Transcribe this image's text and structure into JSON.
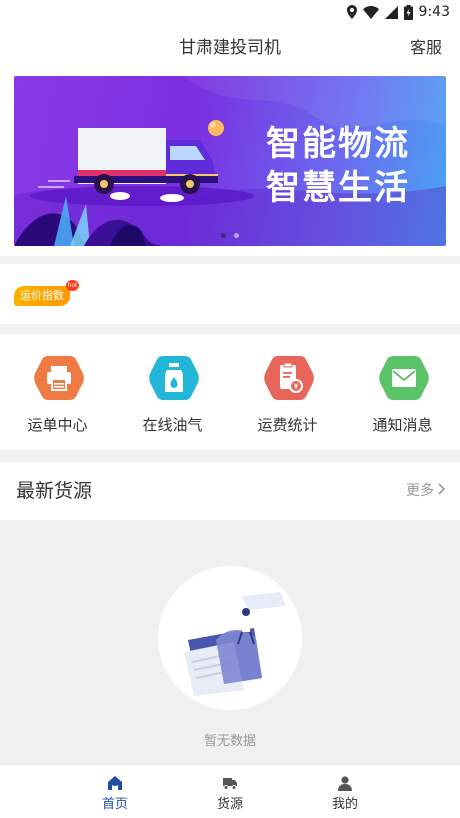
{
  "status_bar": {
    "time": "9:43"
  },
  "header": {
    "title": "甘肃建投司机",
    "service_label": "客服"
  },
  "banner": {
    "slogan_line1": "智能物流",
    "slogan_line2": "智慧生活"
  },
  "rate_index": {
    "label": "运价指数",
    "hot_label": "hot"
  },
  "grid": [
    {
      "label": "运单中心",
      "icon": "printer-icon",
      "color": "#f07a43"
    },
    {
      "label": "在线油气",
      "icon": "fuel-bottle-icon",
      "color": "#22b6d8"
    },
    {
      "label": "运费统计",
      "icon": "freight-bill-icon",
      "color": "#e8655a"
    },
    {
      "label": "通知消息",
      "icon": "envelope-icon",
      "color": "#5cc468"
    }
  ],
  "latest": {
    "title": "最新货源",
    "more_label": "更多",
    "empty_text": "暂无数据"
  },
  "tabbar": [
    {
      "label": "首页",
      "icon": "home-icon",
      "active": true
    },
    {
      "label": "货源",
      "icon": "truck-icon",
      "active": false
    },
    {
      "label": "我的",
      "icon": "user-icon",
      "active": false
    }
  ],
  "colors": {
    "active_tab": "#1e4fa3",
    "banner_purple": "#7a2fe0",
    "banner_blue": "#4aa4f2"
  }
}
